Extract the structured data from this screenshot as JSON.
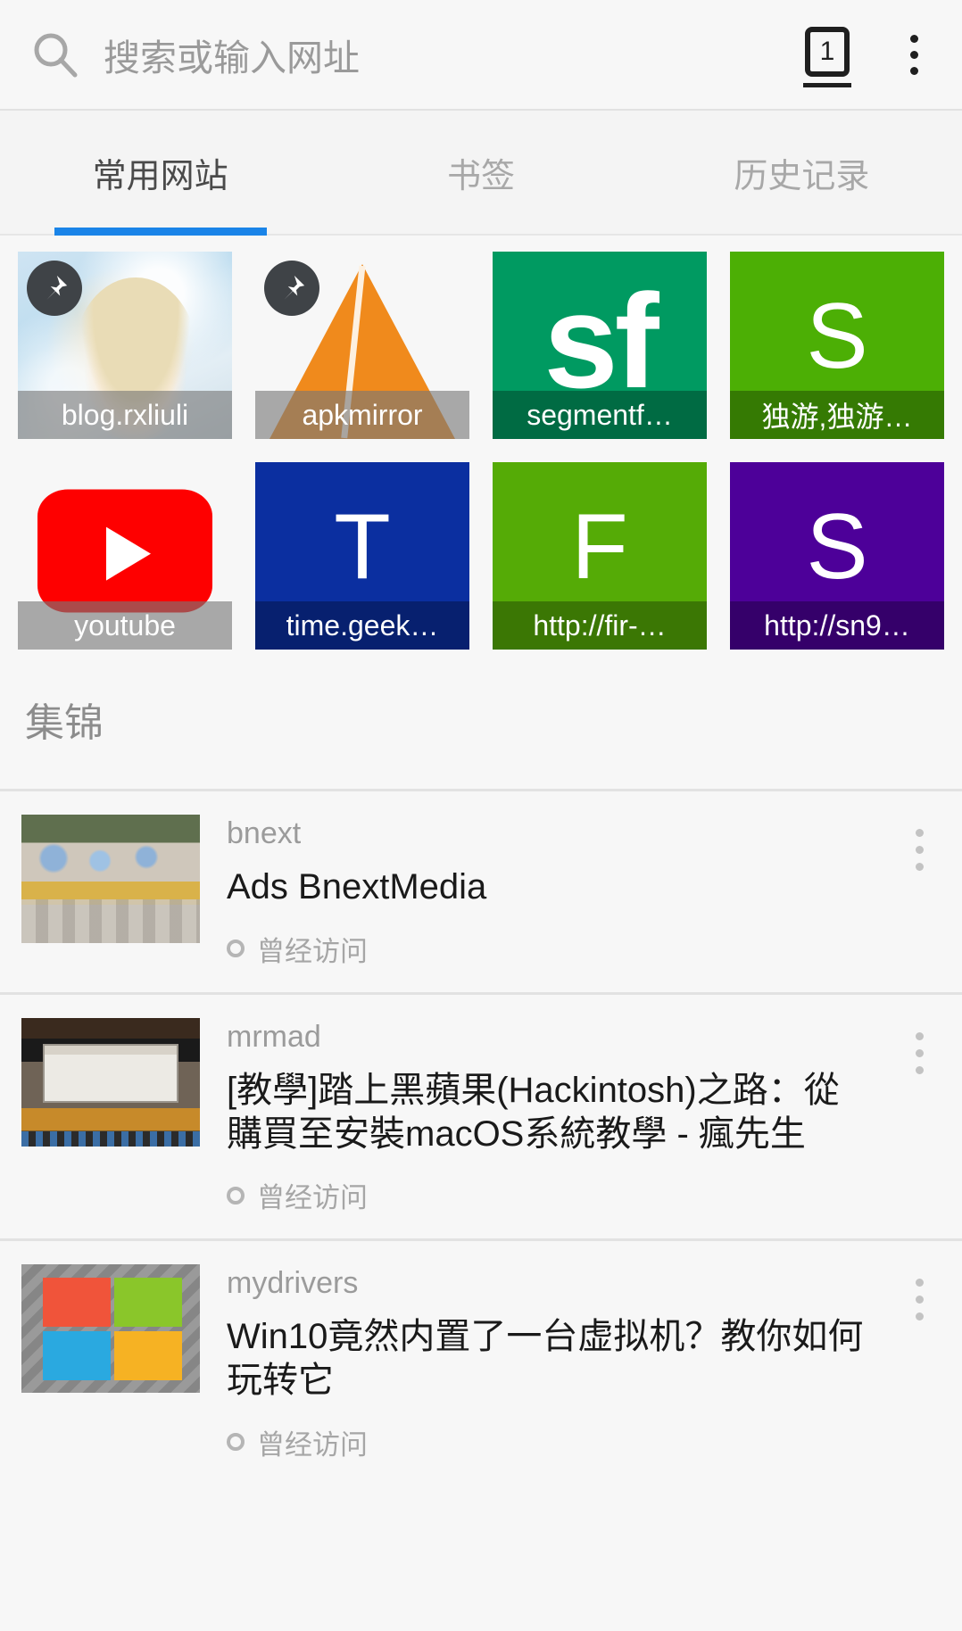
{
  "omnibar": {
    "placeholder": "搜索或输入网址",
    "search_icon": "search-icon",
    "tab_count": "1",
    "menu_icon": "overflow-menu-icon"
  },
  "tabs": [
    {
      "label": "常用网站",
      "active": true
    },
    {
      "label": "书签",
      "active": false
    },
    {
      "label": "历史记录",
      "active": false
    }
  ],
  "tiles": [
    {
      "label": "blog.rxliuli",
      "pinned": true,
      "kind": "image-anime"
    },
    {
      "label": "apkmirror",
      "pinned": true,
      "kind": "apkmirror"
    },
    {
      "label": "segmentf…",
      "pinned": false,
      "kind": "sf",
      "color": "#009a61"
    },
    {
      "label": "独游,独游…",
      "pinned": false,
      "kind": "letter",
      "letter": "S",
      "color": "#4caf05"
    },
    {
      "label": "youtube",
      "pinned": false,
      "kind": "youtube"
    },
    {
      "label": "time.geek…",
      "pinned": false,
      "kind": "letter",
      "letter": "T",
      "color": "#0b2fa0"
    },
    {
      "label": "http://fir-…",
      "pinned": false,
      "kind": "letter",
      "letter": "F",
      "color": "#55ab06"
    },
    {
      "label": "http://sn9…",
      "pinned": false,
      "kind": "letter",
      "letter": "S",
      "color": "#4d0099"
    }
  ],
  "section": {
    "title": "集锦"
  },
  "articles": [
    {
      "source": "bnext",
      "title": "Ads BnextMedia",
      "meta": "曾经访问",
      "thumb": "street-photo"
    },
    {
      "source": "mrmad",
      "title": "[教學]踏上黑蘋果(Hackintosh)之路：從購買至安裝macOS系統教學 - 瘋先生",
      "meta": "曾经访问",
      "thumb": "hackintosh-screenshot"
    },
    {
      "source": "mydrivers",
      "title": "Win10竟然内置了一台虚拟机？教你如何玩转它",
      "meta": "曾经访问",
      "thumb": "windows-logo"
    }
  ],
  "colors": {
    "accent": "#1a84e8",
    "page_bg": "#f7f7f7",
    "divider": "#e2e2e2",
    "muted_text": "#9b9b9b"
  }
}
